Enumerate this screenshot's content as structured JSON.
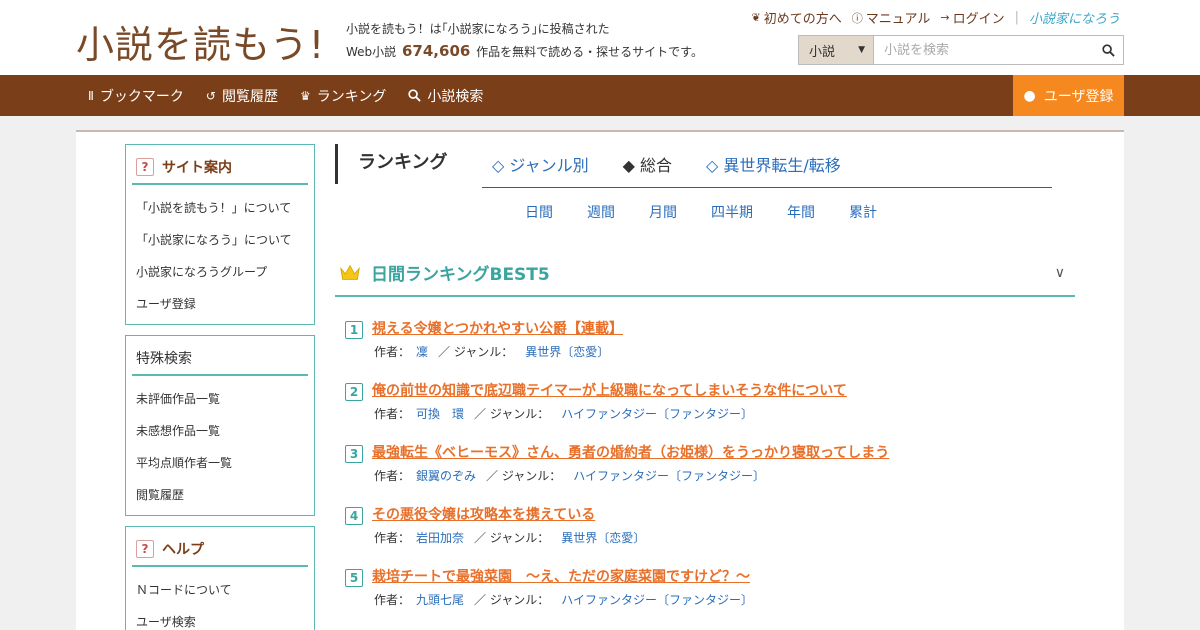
{
  "header": {
    "logo": "小説を読もう!",
    "tagline_line1": "小説を読もう！は｢小説家になろう｣に投稿された",
    "tagline_prefix": "Web小説",
    "work_count": "674,606",
    "tagline_suffix": "作品を無料で読める・探せるサイトです。",
    "links": [
      {
        "label": "初めての方へ",
        "icon": "beginner-icon"
      },
      {
        "label": "マニュアル",
        "icon": "help-circle-icon"
      },
      {
        "label": "ログイン",
        "icon": "login-icon"
      }
    ],
    "narou_logo": "小説家になろう",
    "search": {
      "category": "小説",
      "placeholder": "小説を検索"
    }
  },
  "nav": {
    "items": [
      {
        "label": "ブックマーク",
        "icon": "bookmark-icon"
      },
      {
        "label": "閲覧履歴",
        "icon": "history-icon"
      },
      {
        "label": "ランキング",
        "icon": "crown-icon"
      },
      {
        "label": "小説検索",
        "icon": "search-icon"
      }
    ],
    "register": "ユーザ登録"
  },
  "sidebar": {
    "site_guide": {
      "title": "サイト案内",
      "items": [
        "「小説を読もう！」について",
        "「小説家になろう」について",
        "小説家になろうグループ",
        "ユーザ登録"
      ]
    },
    "special_search": {
      "title": "特殊検索",
      "items": [
        "未評価作品一覧",
        "未感想作品一覧",
        "平均点順作者一覧",
        "閲覧履歴"
      ]
    },
    "help": {
      "title": "ヘルプ",
      "items": [
        "Ｎコードについて",
        "ユーザ検索"
      ]
    }
  },
  "ranking": {
    "heading": "ランキング",
    "tabs": [
      "◇ ジャンル別",
      "◆ 総合",
      "◇ 異世界転生/転移"
    ],
    "active_tab": 1,
    "periods": [
      "日間",
      "週間",
      "月間",
      "四半期",
      "年間",
      "累計"
    ],
    "best_title": "日間ランキングBEST5",
    "author_label": "作者：",
    "genre_label": "／ ジャンル：",
    "items": [
      {
        "num": "1",
        "title": "視える令嬢とつかれやすい公爵【連載】",
        "author": "凜",
        "genre": "異世界〔恋愛〕"
      },
      {
        "num": "2",
        "title": "俺の前世の知識で底辺職テイマーが上級職になってしまいそうな件について",
        "author": "可換　環",
        "genre": "ハイファンタジー〔ファンタジー〕"
      },
      {
        "num": "3",
        "title": "最強転生《ベヒーモス》さん、勇者の婚約者（お姫様）をうっかり寝取ってしまう",
        "author": "銀翼のぞみ",
        "genre": "ハイファンタジー〔ファンタジー〕"
      },
      {
        "num": "4",
        "title": "その悪役令嬢は攻略本を携えている",
        "author": "岩田加奈",
        "genre": "異世界〔恋愛〕"
      },
      {
        "num": "5",
        "title": "栽培チートで最強菜園　～え、ただの家庭菜園ですけど？～",
        "author": "九頭七尾",
        "genre": "ハイファンタジー〔ファンタジー〕"
      }
    ]
  }
}
